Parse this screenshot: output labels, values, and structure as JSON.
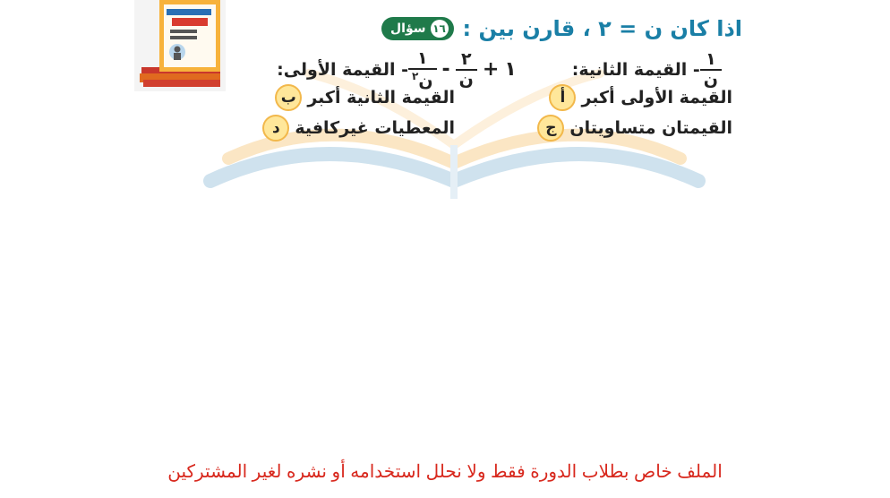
{
  "question": {
    "badge_label": "سؤال",
    "badge_number": "١٦",
    "text": "اذا كان ن = ٢ ، قارن بين :"
  },
  "values": {
    "first_label": "- القيمة الأولى:",
    "second_label": "- القيمة الثانية:",
    "expr_one": "١",
    "expr_plus": "+",
    "expr_two": "٢",
    "expr_n": "ن",
    "expr_minus": "-",
    "expr_n2": "ن",
    "expr_sq": "٢",
    "second_num": "١",
    "second_den": "ن"
  },
  "options": [
    {
      "letter": "أ",
      "text": "القيمة الأولى أكبر"
    },
    {
      "letter": "ب",
      "text": "القيمة الثانية أكبر"
    },
    {
      "letter": "ج",
      "text": "القيمتان متساويتان"
    },
    {
      "letter": "د",
      "text": "المعطيات غيركافية"
    }
  ],
  "footer_notice": "الملف خاص بطلاب الدورة فقط ولا نحلل استخدامه أو نشره لغير المشتركين",
  "colors": {
    "badge": "#1f7a4a",
    "question_text": "#1a7fa6",
    "option_circle": "#ffe79a",
    "footer": "#d8281d",
    "watermark": "#cfe2ee"
  }
}
